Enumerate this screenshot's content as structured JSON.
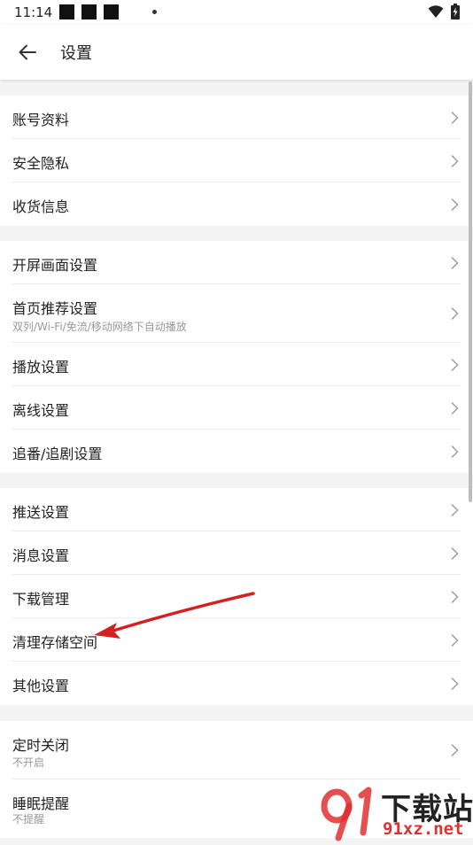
{
  "status_bar": {
    "time": "11:14"
  },
  "header": {
    "title": "设置"
  },
  "groups": [
    {
      "items": [
        {
          "title": "账号资料"
        },
        {
          "title": "安全隐私"
        },
        {
          "title": "收货信息"
        }
      ]
    },
    {
      "items": [
        {
          "title": "开屏画面设置"
        },
        {
          "title": "首页推荐设置",
          "subtitle": "双列/Wi-Fi/免流/移动网络下自动播放"
        },
        {
          "title": "播放设置"
        },
        {
          "title": "离线设置"
        },
        {
          "title": "追番/追剧设置"
        }
      ]
    },
    {
      "items": [
        {
          "title": "推送设置"
        },
        {
          "title": "消息设置"
        },
        {
          "title": "下载管理"
        },
        {
          "title": "清理存储空间"
        },
        {
          "title": "其他设置"
        }
      ]
    },
    {
      "items": [
        {
          "title": "定时关闭",
          "subtitle": "不开启"
        },
        {
          "title": "睡眠提醒",
          "subtitle": "不提醒"
        }
      ]
    }
  ],
  "watermark": {
    "brand_text": "下载站",
    "domain_text": "91xz.net"
  },
  "colors": {
    "annotation_arrow": "#d42020",
    "watermark_red": "#e03030",
    "chevron": "#9e9e9e"
  }
}
